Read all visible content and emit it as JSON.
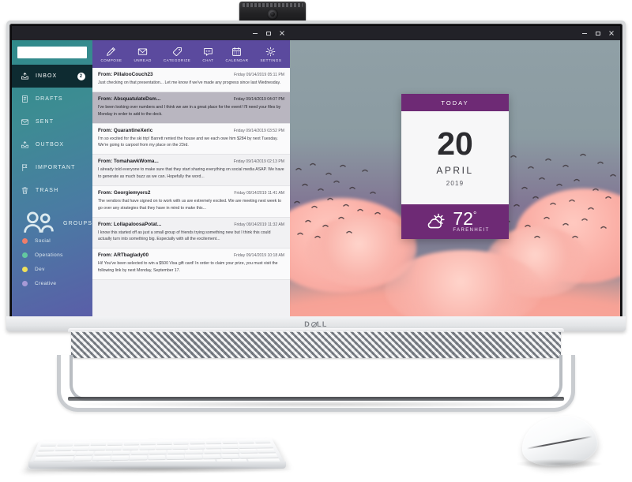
{
  "device": {
    "brand": "DELL",
    "webcam_label": "pop-up-webcam"
  },
  "mail_window": {
    "window_controls": {
      "minimize": "minimize-icon",
      "maximize": "maximize-icon",
      "close": "close-icon"
    },
    "search": {
      "value": "",
      "placeholder": ""
    },
    "nav_items": [
      {
        "label": "INBOX",
        "icon": "inbox-icon",
        "badge": "2",
        "active": true
      },
      {
        "label": "DRAFTS",
        "icon": "drafts-icon",
        "badge": "",
        "active": false
      },
      {
        "label": "SENT",
        "icon": "sent-icon",
        "badge": "",
        "active": false
      },
      {
        "label": "OUTBOX",
        "icon": "outbox-icon",
        "badge": "",
        "active": false
      },
      {
        "label": "IMPORTANT",
        "icon": "flag-icon",
        "badge": "",
        "active": false
      },
      {
        "label": "TRASH",
        "icon": "trash-icon",
        "badge": "",
        "active": false
      }
    ],
    "groups_header": {
      "label": "GROUPS",
      "icon": "people-icon"
    },
    "groups": [
      {
        "label": "Social",
        "color": "#ef7e6a"
      },
      {
        "label": "Operations",
        "color": "#63c9a0"
      },
      {
        "label": "Dev",
        "color": "#efe05a"
      },
      {
        "label": "Creative",
        "color": "#a79ad6"
      }
    ],
    "toolbar": [
      {
        "label": "COMPOSE",
        "icon": "pencil-icon"
      },
      {
        "label": "UNREAD",
        "icon": "envelope-icon"
      },
      {
        "label": "CATEGORIZE",
        "icon": "tag-icon"
      },
      {
        "label": "CHAT",
        "icon": "chat-bubble-icon"
      },
      {
        "label": "CALENDAR",
        "icon": "calendar-icon"
      },
      {
        "label": "SETTINGS",
        "icon": "gear-icon"
      }
    ],
    "messages": [
      {
        "from": "From: PillalooCouch23",
        "date": "Friday 09/14/2019 05:11 PM",
        "snippet": "Just checking on that presentation... Let me know if we've made any progress since last Wednesday."
      },
      {
        "from": "From: AbsquatulateDsm...",
        "date": "Friday 09/14/2019 04:07 PM",
        "snippet": "I've been looking over numbers and I think we are in a great place for the event! I'll need your files by Monday in order to add to the deck."
      },
      {
        "from": "From: QuarantineXeric",
        "date": "Friday 09/14/2019 03:52 PM",
        "snippet": "I'm so excited for the ski trip! Barrett rented the house and we each owe him $284 by next Tuesday. We're going to carpool from my place on the 23rd."
      },
      {
        "from": "From: TomahawkWoma...",
        "date": "Friday 09/14/2019 02:13 PM",
        "snippet": "I already told everyone to make sure that they start sharing everything on social media ASAP. We have to generate as much buzz as we can. Hopefully the word..."
      },
      {
        "from": "From: Georgiemyers2",
        "date": "Friday 09/14/2019 11:41 AM",
        "snippet": "The vendors that have signed on to work with us are extremely excited. We are meeting next week to go over any strategies that they have in mind to make this..."
      },
      {
        "from": "From: LollapaloosaPotat...",
        "date": "Friday 09/14/2019 11:32 AM",
        "snippet": "I know this started off as just a small group of friends trying something new but I think this could actually turn into something big. Especially with all the excitement..."
      },
      {
        "from": "From: ARTbaglady00",
        "date": "Friday 09/14/2019 10:18 AM",
        "snippet": "Hi! You've been selected to win a $500 Visa gift card! In order to claim your prize, you must visit the following link by next Monday, September 17."
      }
    ]
  },
  "wallpaper_window": {
    "window_controls": {
      "minimize": "minimize-icon",
      "maximize": "maximize-icon",
      "close": "close-icon"
    },
    "calendar_widget": {
      "header": "TODAY",
      "day": "20",
      "month": "APRIL",
      "year": "2019",
      "weather_icon": "sun-behind-cloud-icon",
      "temperature": "72",
      "degree_symbol": "°",
      "unit": "FARENHEIT",
      "accent_color": "#6e2a75"
    }
  }
}
